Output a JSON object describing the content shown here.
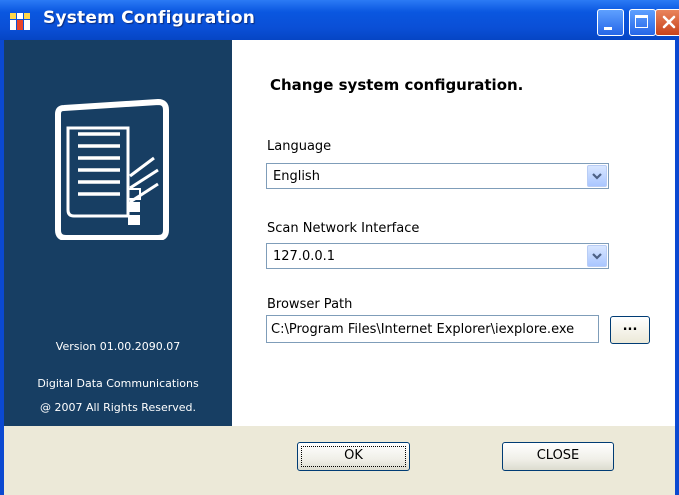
{
  "window": {
    "title": "System Configuration",
    "controls": [
      "minimize",
      "maximize",
      "close"
    ]
  },
  "sidebar": {
    "version": "Version 01.00.2090.07",
    "company": "Digital Data Communications",
    "copyright": "@ 2007 All Rights Reserved.",
    "icon": "server-storage-icon",
    "background": "#173e63"
  },
  "form": {
    "heading": "Change system configuration.",
    "language": {
      "label": "Language",
      "value": "English"
    },
    "scan_interface": {
      "label": "Scan Network Interface",
      "value": "127.0.0.1"
    },
    "browser_path": {
      "label": "Browser Path",
      "value": "C:\\Program Files\\Internet Explorer\\iexplore.exe",
      "browse_label": "..."
    }
  },
  "buttons": {
    "ok_label": "OK",
    "close_label": "CLOSE"
  },
  "colors": {
    "titlebar": "#0a57e0",
    "close_button": "#d4512a",
    "dialog_bg": "#ece9d8"
  }
}
